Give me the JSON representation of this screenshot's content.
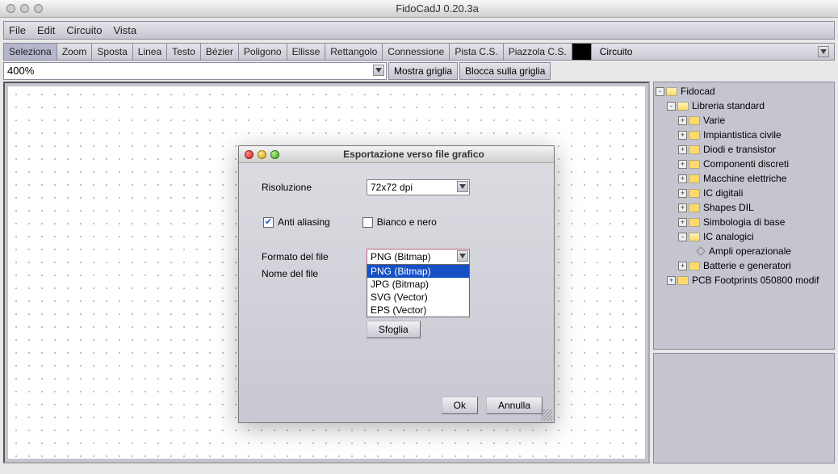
{
  "title": "FidoCadJ 0.20.3a",
  "menu": {
    "file": "File",
    "edit": "Edit",
    "circuito": "Circuito",
    "vista": "Vista"
  },
  "tools": {
    "seleziona": "Seleziona",
    "zoom": "Zoom",
    "sposta": "Sposta",
    "linea": "Linea",
    "testo": "Testo",
    "bezier": "Bézier",
    "poligono": "Poligono",
    "ellisse": "Ellisse",
    "rettangolo": "Rettangolo",
    "connessione": "Connessione",
    "pistacs": "Pista C.S.",
    "piazzola": "Piazzola C.S.",
    "circuito_label": "Circuito"
  },
  "zoom_value": "400%",
  "grid": {
    "mostra": "Mostra griglia",
    "blocca": "Blocca sulla griglia"
  },
  "tree": {
    "root": "Fidocad",
    "std": "Libreria standard",
    "items": {
      "varie": "Varie",
      "impiantistica": "Impiantistica civile",
      "diodi": "Diodi e transistor",
      "componenti": "Componenti discreti",
      "macchine": "Macchine elettriche",
      "icdig": "IC digitali",
      "shapes": "Shapes DIL",
      "simbologia": "Simbologia di base",
      "icanal": "IC analogici",
      "ampli": "Ampli operazionale",
      "batterie": "Batterie e generatori"
    },
    "pcb": "PCB Footprints 050800 modif"
  },
  "dialog": {
    "title": "Esportazione verso file grafico",
    "risoluzione": "Risoluzione",
    "risoluzione_val": "72x72 dpi",
    "antialias": "Anti aliasing",
    "bianconero": "Bianco e nero",
    "formato": "Formato del file",
    "formato_val": "PNG (Bitmap)",
    "formato_options": {
      "png": "PNG (Bitmap)",
      "jpg": "JPG (Bitmap)",
      "svg": "SVG (Vector)",
      "eps": "EPS (Vector)"
    },
    "nome": "Nome del file",
    "sfoglia": "Sfoglia",
    "ok": "Ok",
    "annulla": "Annulla"
  }
}
